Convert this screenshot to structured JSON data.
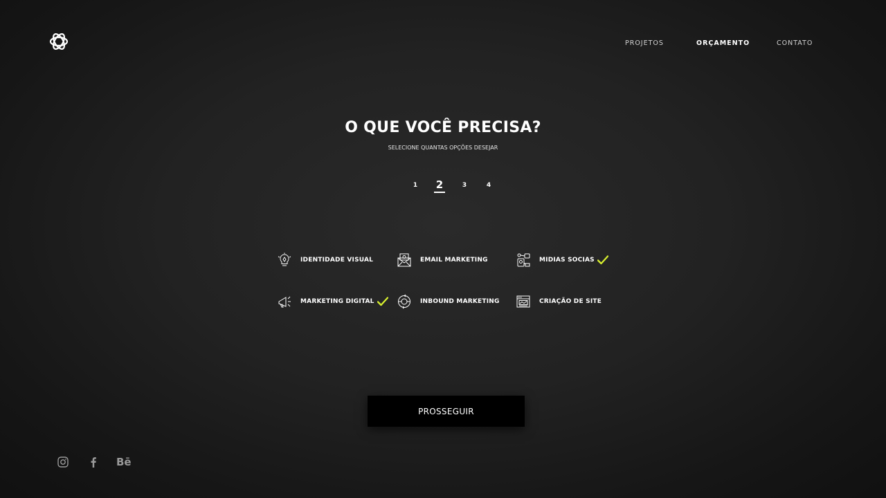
{
  "header": {
    "logo_icon": "knot-logo-icon",
    "nav": [
      {
        "label": "PROJETOS",
        "active": false
      },
      {
        "label": "ORÇAMENTO",
        "active": true
      },
      {
        "label": "CONTATO",
        "active": false
      }
    ]
  },
  "main": {
    "title": "O QUE VOCÊ PRECISA?",
    "subtitle": "SELECIONE QUANTAS OPÇÕES DESEJAR",
    "steps": [
      {
        "label": "1",
        "current": false
      },
      {
        "label": "2",
        "current": true
      },
      {
        "label": "3",
        "current": false
      },
      {
        "label": "4",
        "current": false
      }
    ],
    "options": [
      {
        "label": "IDENTIDADE VISUAL",
        "icon": "lightbulb-pen-icon",
        "selected": false
      },
      {
        "label": "EMAIL MARKETING",
        "icon": "envelope-icon",
        "selected": false
      },
      {
        "label": "MIDIAS SOCIAS",
        "icon": "social-media-icon",
        "selected": true
      },
      {
        "label": "MARKETING DIGITAL",
        "icon": "megaphone-icon",
        "selected": true
      },
      {
        "label": "INBOUND MARKETING",
        "icon": "inbound-cycle-icon",
        "selected": false
      },
      {
        "label": "CRIAÇÃO DE SITE",
        "icon": "browser-window-icon",
        "selected": false
      }
    ],
    "continue_label": "PROSSEGUIR"
  },
  "footer": {
    "social": [
      {
        "icon": "instagram-icon"
      },
      {
        "icon": "facebook-icon"
      },
      {
        "icon": "behance-icon",
        "label": "Bē"
      }
    ]
  },
  "colors": {
    "background": "#1f1f1f",
    "text": "#ffffff",
    "check": "#d7ef2f",
    "button": "#000000",
    "social": "#9a9a9a"
  }
}
